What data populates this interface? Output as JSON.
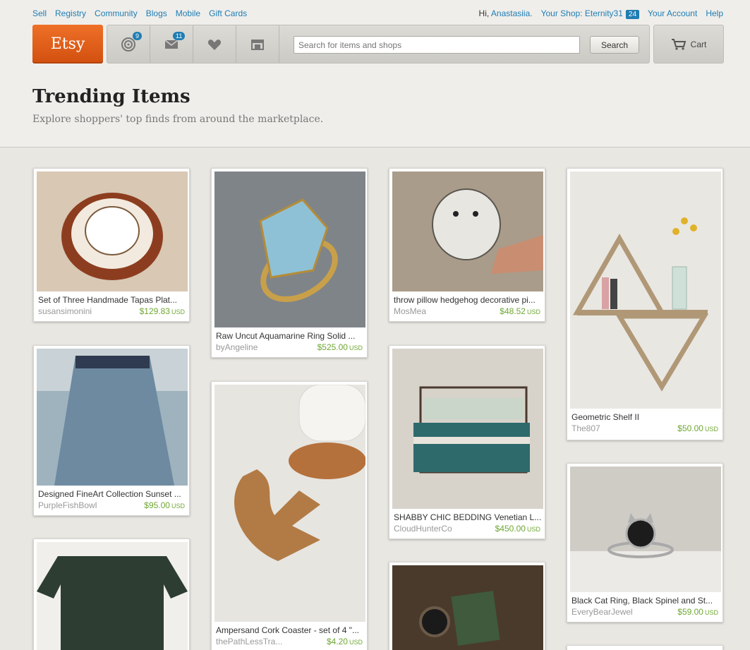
{
  "header": {
    "left_links": [
      "Sell",
      "Registry",
      "Community",
      "Blogs",
      "Mobile",
      "Gift Cards"
    ],
    "greeting": "Hi,",
    "user_name": "Anastasiia.",
    "your_shop_label": "Your Shop: Eternity31",
    "shop_badge": "24",
    "your_account": "Your Account",
    "help": "Help"
  },
  "nav": {
    "logo": "Etsy",
    "activity_badge": "9",
    "messages_badge": "11",
    "search_placeholder": "Search for items and shops",
    "search_button": "Search",
    "cart_label": "Cart",
    "icons": [
      "activity-icon",
      "messages-icon",
      "favorites-heart-icon",
      "shop-store-icon",
      "cart-icon"
    ]
  },
  "page": {
    "title": "Trending Items",
    "subtitle": "Explore shoppers' top finds from around the marketplace."
  },
  "items": [
    {
      "title": "Set of Three Handmade Tapas Plat...",
      "shop": "susansimonini",
      "price": "$129.83",
      "currency": "USD",
      "img_color": "#d8c8b4"
    },
    {
      "title": "Designed FineArt Collection Sunset ...",
      "shop": "PurpleFishBowl",
      "price": "$95.00",
      "currency": "USD",
      "img_color": "#9fb3bf"
    },
    {
      "title": "",
      "shop": "",
      "price": "",
      "currency": "",
      "img_color": "#2d3d32"
    },
    {
      "title": "Raw Uncut Aquamarine Ring Solid ...",
      "shop": "byAngeline",
      "price": "$525.00",
      "currency": "USD",
      "img_color": "#7f8489"
    },
    {
      "title": "Ampersand Cork Coaster - set of 4 \"...",
      "shop": "thePathLessTra...",
      "price": "$4.20",
      "currency": "USD",
      "img_color": "#e7e5e0"
    },
    {
      "title": "throw pillow hedgehog decorative pi...",
      "shop": "MosMea",
      "price": "$48.52",
      "currency": "USD",
      "img_color": "#a99c8a"
    },
    {
      "title": "SHABBY CHIC BEDDING Venetian L...",
      "shop": "CloudHunterCo",
      "price": "$450.00",
      "currency": "USD",
      "img_color": "#d7d3cb"
    },
    {
      "title": "",
      "shop": "",
      "price": "",
      "currency": "",
      "img_color": "#4a3a2c"
    },
    {
      "title": "Geometric Shelf II",
      "shop": "The807",
      "price": "$50.00",
      "currency": "USD",
      "img_color": "#e9e7e2"
    },
    {
      "title": "Black Cat Ring, Black Spinel and St...",
      "shop": "EveryBearJewel",
      "price": "$59.00",
      "currency": "USD",
      "img_color": "#cfccc6"
    }
  ]
}
